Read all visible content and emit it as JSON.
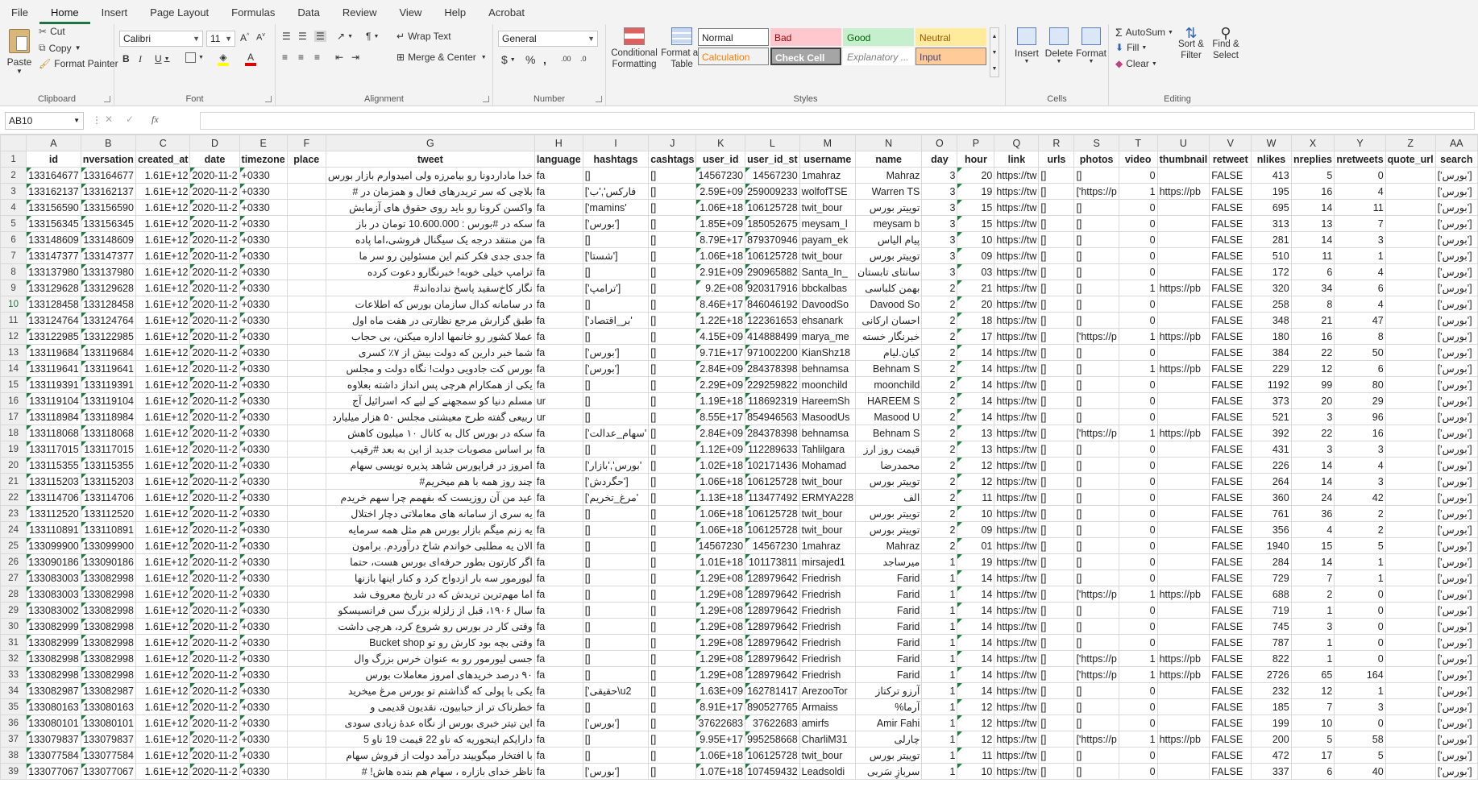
{
  "menu": [
    "File",
    "Home",
    "Insert",
    "Page Layout",
    "Formulas",
    "Data",
    "Review",
    "View",
    "Help",
    "Acrobat"
  ],
  "ribbon": {
    "clipboard": {
      "label": "Clipboard",
      "paste": "Paste",
      "cut": "Cut",
      "copy": "Copy",
      "format_painter": "Format Painter"
    },
    "font": {
      "label": "Font",
      "name": "Calibri",
      "size": "11"
    },
    "alignment": {
      "label": "Alignment",
      "wrap": "Wrap Text",
      "merge": "Merge & Center"
    },
    "number": {
      "label": "Number",
      "format": "General"
    },
    "styles": {
      "label": "Styles",
      "conditional": "Conditional Formatting",
      "format_table": "Format as Table",
      "cells": [
        [
          "Normal",
          "Bad",
          "Good",
          "Neutral"
        ],
        [
          "Calculation",
          "Check Cell",
          "Explanatory ...",
          "Input"
        ]
      ]
    },
    "cells": {
      "label": "Cells",
      "insert": "Insert",
      "delete": "Delete",
      "format": "Format"
    },
    "editing": {
      "label": "Editing",
      "autosum": "AutoSum",
      "fill": "Fill",
      "clear": "Clear",
      "sort": "Sort & Filter",
      "find": "Find & Select"
    }
  },
  "formula_bar": {
    "namebox": "AB10",
    "fx": "fx",
    "value": ""
  },
  "columns": [
    "A",
    "B",
    "C",
    "D",
    "E",
    "F",
    "G",
    "H",
    "I",
    "J",
    "K",
    "L",
    "M",
    "N",
    "O",
    "P",
    "Q",
    "R",
    "S",
    "T",
    "U",
    "V",
    "W",
    "X",
    "Y",
    "Z",
    "AA"
  ],
  "header_row": [
    "id",
    "nversation",
    "created_at",
    "date",
    "timezone",
    "place",
    "tweet",
    "language",
    "hashtags",
    "cashtags",
    "user_id",
    "user_id_st",
    "username",
    "name",
    "day",
    "hour",
    "link",
    "urls",
    "photos",
    "video",
    "thumbnail",
    "retweet",
    "nlikes",
    "nreplies",
    "nretweets",
    "quote_url",
    "search"
  ],
  "rows": [
    [
      "133164677",
      "133164677",
      "1.61E+12",
      "2020-11-2",
      "+0330",
      "",
      "خدا ماداردونا رو بیامرزه ولی امیدوارم بازار بورس",
      "fa",
      "[]",
      "[]",
      "14567230",
      "14567230",
      "1mahraz",
      "Mahraz",
      "3",
      "20",
      "https://tw",
      "[]",
      "[]",
      "0",
      "",
      "FALSE",
      "413",
      "5",
      "0",
      "",
      "['بورس']"
    ],
    [
      "133162137",
      "133162137",
      "1.61E+12",
      "2020-11-2",
      "+0330",
      "",
      "بلاچی که سر تریدرهای فعال و همزمان در #",
      "fa",
      "['فارکس','ب",
      "[]",
      "2.59E+09",
      "259009233",
      "wolfofTSE",
      "Warren TS",
      "3",
      "19",
      "https://tw",
      "[]",
      "['https://p",
      "1",
      "https://pb",
      "FALSE",
      "195",
      "16",
      "4",
      "",
      "['بورس']"
    ],
    [
      "133156590",
      "133156590",
      "1.61E+12",
      "2020-11-2",
      "+0330",
      "",
      "واکسن کرونا رو باید روی حقوق های آزمایش",
      "fa",
      "['mamins'",
      "[]",
      "1.06E+18",
      "106125728",
      "twit_bour",
      "توییتر بورس",
      "3",
      "15",
      "https://tw",
      "[]",
      "[]",
      "0",
      "",
      "FALSE",
      "695",
      "14",
      "11",
      "",
      "['بورس']"
    ],
    [
      "133156345",
      "133156345",
      "1.61E+12",
      "2020-11-2",
      "+0330",
      "",
      "سکه در #بورس : 10.600.000 تومان در باز",
      "fa",
      "['بورس']",
      "[]",
      "1.85E+09",
      "185052675",
      "meysam_l",
      "meysam b",
      "3",
      "15",
      "https://tw",
      "[]",
      "[]",
      "0",
      "",
      "FALSE",
      "313",
      "13",
      "7",
      "",
      "['بورس']"
    ],
    [
      "133148609",
      "133148609",
      "1.61E+12",
      "2020-11-2",
      "+0330",
      "",
      "من منتقد درجه یک سیگنال فروشی،اما پاده",
      "fa",
      "[]",
      "[]",
      "8.79E+17",
      "879370946",
      "payam_ek",
      "پیام الیاس",
      "3",
      "10",
      "https://tw",
      "[]",
      "[]",
      "0",
      "",
      "FALSE",
      "281",
      "14",
      "3",
      "",
      "['بورس']"
    ],
    [
      "133147377",
      "133147377",
      "1.61E+12",
      "2020-11-2",
      "+0330",
      "",
      "جدی جدی فکر کنم این مسئولین رو سر ما",
      "fa",
      "['شستا']",
      "[]",
      "1.06E+18",
      "106125728",
      "twit_bour",
      "توییتر بورس",
      "3",
      "09",
      "https://tw",
      "[]",
      "[]",
      "0",
      "",
      "FALSE",
      "510",
      "11",
      "1",
      "",
      "['بورس']"
    ],
    [
      "133137980",
      "133137980",
      "1.61E+12",
      "2020-11-2",
      "+0330",
      "",
      "ترامپ خیلی خوبه! خبرنگارو دعوت کرده",
      "fa",
      "[]",
      "[]",
      "2.91E+09",
      "290965882",
      "Santa_In_",
      "سانتای تابستان",
      "3",
      "03",
      "https://tw",
      "[]",
      "[]",
      "0",
      "",
      "FALSE",
      "172",
      "6",
      "4",
      "",
      "['بورس']"
    ],
    [
      "133129628",
      "133129628",
      "1.61E+12",
      "2020-11-2",
      "+0330",
      "",
      "نگار کاخ‌سفید پاسخ نداده‌اند#",
      "fa",
      "['ترامپ']",
      "[]",
      "9.2E+08",
      "920317916",
      "bbckalbas",
      "بهمن کلباسی",
      "2",
      "21",
      "https://tw",
      "[]",
      "[]",
      "1",
      "https://pb",
      "FALSE",
      "320",
      "34",
      "6",
      "",
      "['بورس']"
    ],
    [
      "133128458",
      "133128458",
      "1.61E+12",
      "2020-11-2",
      "+0330",
      "",
      "در سامانه کدال سازمان بورس که اطلاعات",
      "fa",
      "[]",
      "[]",
      "8.46E+17",
      "846046192",
      "DavoodSo",
      "Davood So",
      "2",
      "20",
      "https://tw",
      "[]",
      "[]",
      "0",
      "",
      "FALSE",
      "258",
      "8",
      "4",
      "",
      "['بورس']"
    ],
    [
      "133124764",
      "133124764",
      "1.61E+12",
      "2020-11-2",
      "+0330",
      "",
      "طبق گزارش مرجع نظارتی در هفت ماه اول",
      "fa",
      "['بر_اقتصاد'",
      "[]",
      "1.22E+18",
      "122361653",
      "ehsanark",
      "احسان ارکانی",
      "2",
      "18",
      "https://tw",
      "[]",
      "[]",
      "0",
      "",
      "FALSE",
      "348",
      "21",
      "47",
      "",
      "['بورس']"
    ],
    [
      "133122985",
      "133122985",
      "1.61E+12",
      "2020-11-2",
      "+0330",
      "",
      "عملا کشور رو خانمها اداره میکنن، بی حجاب",
      "fa",
      "[]",
      "[]",
      "4.15E+09",
      "414888499",
      "marya_me",
      "خبرنگار خسته",
      "2",
      "17",
      "https://tw",
      "[]",
      "['https://p",
      "1",
      "https://pb",
      "FALSE",
      "180",
      "16",
      "8",
      "",
      "['بورس']"
    ],
    [
      "133119684",
      "133119684",
      "1.61E+12",
      "2020-11-2",
      "+0330",
      "",
      "شما خبر دارین که دولت بیش از ۷٪ کسری",
      "fa",
      "['بورس']",
      "[]",
      "9.71E+17",
      "971002200",
      "KianShz18",
      "کیان.لیام",
      "2",
      "14",
      "https://tw",
      "[]",
      "[]",
      "0",
      "",
      "FALSE",
      "384",
      "22",
      "50",
      "",
      "['بورس']"
    ],
    [
      "133119641",
      "133119641",
      "1.61E+12",
      "2020-11-2",
      "+0330",
      "",
      "بورس کت جادویی دولت!  نگاه دولت و مجلس",
      "fa",
      "['بورس']",
      "[]",
      "2.84E+09",
      "284378398",
      "behnamsa",
      "Behnam S",
      "2",
      "14",
      "https://tw",
      "[]",
      "[]",
      "1",
      "https://pb",
      "FALSE",
      "229",
      "12",
      "6",
      "",
      "['بورس']"
    ],
    [
      "133119391",
      "133119391",
      "1.61E+12",
      "2020-11-2",
      "+0330",
      "",
      "یکی از همکارام هرچی پس انداز داشته بعلاوه",
      "fa",
      "[]",
      "[]",
      "2.29E+09",
      "229259822",
      "moonchild",
      "moonchild",
      "2",
      "14",
      "https://tw",
      "[]",
      "[]",
      "0",
      "",
      "FALSE",
      "1192",
      "99",
      "80",
      "",
      "['بورس']"
    ],
    [
      "133119104",
      "133119104",
      "1.61E+12",
      "2020-11-2",
      "+0330",
      "",
      "مسلم دنیا کو سمجھنے کے لیے کہ اسرائیل آج",
      "ur",
      "[]",
      "[]",
      "1.19E+18",
      "118692319",
      "HareemSh",
      "HAREEM S",
      "2",
      "14",
      "https://tw",
      "[]",
      "[]",
      "0",
      "",
      "FALSE",
      "373",
      "20",
      "29",
      "",
      "['بورس']"
    ],
    [
      "133118984",
      "133118984",
      "1.61E+12",
      "2020-11-2",
      "+0330",
      "",
      "ربیعی گفته طرح معیشتی مجلس ۵۰ هزار میلیارد",
      "ur",
      "[]",
      "[]",
      "8.55E+17",
      "854946563",
      "MasoodUs",
      "Masood U",
      "2",
      "14",
      "https://tw",
      "[]",
      "[]",
      "0",
      "",
      "FALSE",
      "521",
      "3",
      "96",
      "",
      "['بورس']"
    ],
    [
      "133118068",
      "133118068",
      "1.61E+12",
      "2020-11-2",
      "+0330",
      "",
      "سکه در بورس کال به کانال ۱۰ میلیون کاهش",
      "fa",
      "['سهام_عدالت'",
      "[]",
      "2.84E+09",
      "284378398",
      "behnamsa",
      "Behnam S",
      "2",
      "13",
      "https://tw",
      "[]",
      "['https://p",
      "1",
      "https://pb",
      "FALSE",
      "392",
      "22",
      "16",
      "",
      "['بورس']"
    ],
    [
      "133117015",
      "133117015",
      "1.61E+12",
      "2020-11-2",
      "+0330",
      "",
      "بر اساس مصوبات جدید از این به بعد #رقیب",
      "fa",
      "[]",
      "[]",
      "1.12E+09",
      "112289633",
      "Tahlilgara",
      "قیمت روز ارز",
      "2",
      "13",
      "https://tw",
      "[]",
      "[]",
      "0",
      "",
      "FALSE",
      "431",
      "3",
      "3",
      "",
      "['بورس']"
    ],
    [
      "133115355",
      "133115355",
      "1.61E+12",
      "2020-11-2",
      "+0330",
      "",
      "امروز در فراپورس شاهد پذیره نویسی سهام",
      "fa",
      "['بورس','بازار'",
      "[]",
      "1.02E+18",
      "102171436",
      "Mohamad",
      "محمدرضا",
      "2",
      "12",
      "https://tw",
      "[]",
      "[]",
      "0",
      "",
      "FALSE",
      "226",
      "14",
      "4",
      "",
      "['بورس']"
    ],
    [
      "133115203",
      "133115203",
      "1.61E+12",
      "2020-11-2",
      "+0330",
      "",
      "چند روز همه با هم میخریم#",
      "fa",
      "['حگردش']",
      "[]",
      "1.06E+18",
      "106125728",
      "twit_bour",
      "توییتر بورس",
      "2",
      "12",
      "https://tw",
      "[]",
      "[]",
      "0",
      "",
      "FALSE",
      "264",
      "14",
      "3",
      "",
      "['بورس']"
    ],
    [
      "133114706",
      "133114706",
      "1.61E+12",
      "2020-11-2",
      "+0330",
      "",
      "عید من آن روزیست که بفهمم چرا سهم خریدم",
      "fa",
      "['مرغ_تخریم'",
      "[]",
      "1.13E+18",
      "113477492",
      "ERMYA228",
      "الف",
      "2",
      "11",
      "https://tw",
      "[]",
      "[]",
      "0",
      "",
      "FALSE",
      "360",
      "24",
      "42",
      "",
      "['بورس']"
    ],
    [
      "133112520",
      "133112520",
      "1.61E+12",
      "2020-11-2",
      "+0330",
      "",
      "یه سری از سامانه های معاملاتی دچار اختلال",
      "fa",
      "[]",
      "[]",
      "1.06E+18",
      "106125728",
      "twit_bour",
      "توییتر بورس",
      "2",
      "10",
      "https://tw",
      "[]",
      "[]",
      "0",
      "",
      "FALSE",
      "761",
      "36",
      "2",
      "",
      "['بورس']"
    ],
    [
      "133110891",
      "133110891",
      "1.61E+12",
      "2020-11-2",
      "+0330",
      "",
      "یه زنم میگم بازار بورس هم مثل همه سرمایه",
      "fa",
      "[]",
      "[]",
      "1.06E+18",
      "106125728",
      "twit_bour",
      "توییتر بورس",
      "2",
      "09",
      "https://tw",
      "[]",
      "[]",
      "0",
      "",
      "FALSE",
      "356",
      "4",
      "2",
      "",
      "['بورس']"
    ],
    [
      "133099900",
      "133099900",
      "1.61E+12",
      "2020-11-2",
      "+0330",
      "",
      "الان یه مطلبی خواندم شاخ درآوردم. برامون",
      "fa",
      "[]",
      "[]",
      "14567230",
      "14567230",
      "1mahraz",
      "Mahraz",
      "2",
      "01",
      "https://tw",
      "[]",
      "[]",
      "0",
      "",
      "FALSE",
      "1940",
      "15",
      "5",
      "",
      "['بورس']"
    ],
    [
      "133090186",
      "133090186",
      "1.61E+12",
      "2020-11-2",
      "+0330",
      "",
      "اگر کارتون بطور حرفه‌ای بورس هست، حتما",
      "fa",
      "[]",
      "[]",
      "1.01E+18",
      "101173811",
      "mirsajed1",
      "میرساجد",
      "1",
      "19",
      "https://tw",
      "[]",
      "[]",
      "0",
      "",
      "FALSE",
      "284",
      "14",
      "1",
      "",
      "['بورس']"
    ],
    [
      "133083003",
      "133082998",
      "1.61E+12",
      "2020-11-2",
      "+0330",
      "",
      "لیورمور سه بار ازدواج کرد و کنار اینها بازنها",
      "fa",
      "[]",
      "[]",
      "1.29E+08",
      "128979642",
      "Friedrish",
      "Farid",
      "1",
      "14",
      "https://tw",
      "[]",
      "[]",
      "0",
      "",
      "FALSE",
      "729",
      "7",
      "1",
      "",
      "['بورس']"
    ],
    [
      "133083003",
      "133082998",
      "1.61E+12",
      "2020-11-2",
      "+0330",
      "",
      "اما مهم‌ترین تریدش که در تاریخ معروف شد",
      "fa",
      "[]",
      "[]",
      "1.29E+08",
      "128979642",
      "Friedrish",
      "Farid",
      "1",
      "14",
      "https://tw",
      "[]",
      "['https://p",
      "1",
      "https://pb",
      "FALSE",
      "688",
      "2",
      "0",
      "",
      "['بورس']"
    ],
    [
      "133083002",
      "133082998",
      "1.61E+12",
      "2020-11-2",
      "+0330",
      "",
      "سال ۱۹۰۶، قبل از زلزله بزرگ سن فرانسیسکو",
      "fa",
      "[]",
      "[]",
      "1.29E+08",
      "128979642",
      "Friedrish",
      "Farid",
      "1",
      "14",
      "https://tw",
      "[]",
      "[]",
      "0",
      "",
      "FALSE",
      "719",
      "1",
      "0",
      "",
      "['بورس']"
    ],
    [
      "133082999",
      "133082998",
      "1.61E+12",
      "2020-11-2",
      "+0330",
      "",
      "وقتی کار در بورس رو شروع کرد، هرچی داشت",
      "fa",
      "[]",
      "[]",
      "1.29E+08",
      "128979642",
      "Friedrish",
      "Farid",
      "1",
      "14",
      "https://tw",
      "[]",
      "[]",
      "0",
      "",
      "FALSE",
      "745",
      "3",
      "0",
      "",
      "['بورس']"
    ],
    [
      "133082999",
      "133082998",
      "1.61E+12",
      "2020-11-2",
      "+0330",
      "",
      "وقتی بچه بود کارش رو تو Bucket shop",
      "fa",
      "[]",
      "[]",
      "1.29E+08",
      "128979642",
      "Friedrish",
      "Farid",
      "1",
      "14",
      "https://tw",
      "[]",
      "[]",
      "0",
      "",
      "FALSE",
      "787",
      "1",
      "0",
      "",
      "['بورس']"
    ],
    [
      "133082998",
      "133082998",
      "1.61E+12",
      "2020-11-2",
      "+0330",
      "",
      "جسی لیورمور رو به عنوان خرس بزرگ وال",
      "fa",
      "[]",
      "[]",
      "1.29E+08",
      "128979642",
      "Friedrish",
      "Farid",
      "1",
      "14",
      "https://tw",
      "[]",
      "['https://p",
      "1",
      "https://pb",
      "FALSE",
      "822",
      "1",
      "0",
      "",
      "['بورس']"
    ],
    [
      "133082998",
      "133082998",
      "1.61E+12",
      "2020-11-2",
      "+0330",
      "",
      "۹۰ درصد خریدهای امروز معاملات بورس",
      "fa",
      "[]",
      "[]",
      "1.29E+08",
      "128979642",
      "Friedrish",
      "Farid",
      "1",
      "14",
      "https://tw",
      "[]",
      "['https://p",
      "1",
      "https://pb",
      "FALSE",
      "2726",
      "65",
      "164",
      "",
      "['بورس']"
    ],
    [
      "133082987",
      "133082987",
      "1.61E+12",
      "2020-11-2",
      "+0330",
      "",
      "یکی با پولی که گذاشتم تو بورس مرغ میخرید",
      "fa",
      "['حقیقی\\u2",
      "[]",
      "1.63E+09",
      "162781417",
      "ArezooTor",
      "آرزو ترکتاز",
      "1",
      "14",
      "https://tw",
      "[]",
      "[]",
      "0",
      "",
      "FALSE",
      "232",
      "12",
      "1",
      "",
      "['بورس']"
    ],
    [
      "133080163",
      "133080163",
      "1.61E+12",
      "2020-11-2",
      "+0330",
      "",
      "خطرناک تر از حبابیون، نقدیون قدیمی و",
      "fa",
      "[]",
      "[]",
      "8.91E+17",
      "890527765",
      "Armaiss",
      "آرما%",
      "1",
      "12",
      "https://tw",
      "[]",
      "[]",
      "0",
      "",
      "FALSE",
      "185",
      "7",
      "3",
      "",
      "['بورس']"
    ],
    [
      "133080101",
      "133080101",
      "1.61E+12",
      "2020-11-2",
      "+0330",
      "",
      "این تیتر خبری بورس از نگاه عدهٔ زیادی سودی",
      "fa",
      "['بورس']",
      "[]",
      "37622683",
      "37622683",
      "amirfs",
      "Amir Fahi",
      "1",
      "12",
      "https://tw",
      "[]",
      "[]",
      "0",
      "",
      "FALSE",
      "199",
      "10",
      "0",
      "",
      "['بورس']"
    ],
    [
      "133079837",
      "133079837",
      "1.61E+12",
      "2020-11-2",
      "+0330",
      "",
      "دارایکم اینجوریه که  ناو 22 قیمت 19 ناو 5",
      "fa",
      "[]",
      "[]",
      "9.95E+17",
      "995258668",
      "CharliM31",
      "چارلی",
      "1",
      "12",
      "https://tw",
      "[]",
      "['https://p",
      "1",
      "https://pb",
      "FALSE",
      "200",
      "5",
      "58",
      "",
      "['بورس']"
    ],
    [
      "133077584",
      "133077584",
      "1.61E+12",
      "2020-11-2",
      "+0330",
      "",
      "با افتخار میگوییند درآمد دولت از فروش سهام",
      "fa",
      "[]",
      "[]",
      "1.06E+18",
      "106125728",
      "twit_bour",
      "توییتر بورس",
      "1",
      "11",
      "https://tw",
      "[]",
      "[]",
      "0",
      "",
      "FALSE",
      "472",
      "17",
      "5",
      "",
      "['بورس']"
    ],
    [
      "133077067",
      "133077067",
      "1.61E+12",
      "2020-11-2",
      "+0330",
      "",
      "ناظر خدای بازاره ، سهام هم بنده هاش! #",
      "fa",
      "['بورس']",
      "[]",
      "1.07E+18",
      "107459432",
      "Leadsoldi",
      "سربازِ سَربی",
      "1",
      "10",
      "https://tw",
      "[]",
      "[]",
      "0",
      "",
      "FALSE",
      "337",
      "6",
      "40",
      "",
      "['بورس']"
    ]
  ]
}
